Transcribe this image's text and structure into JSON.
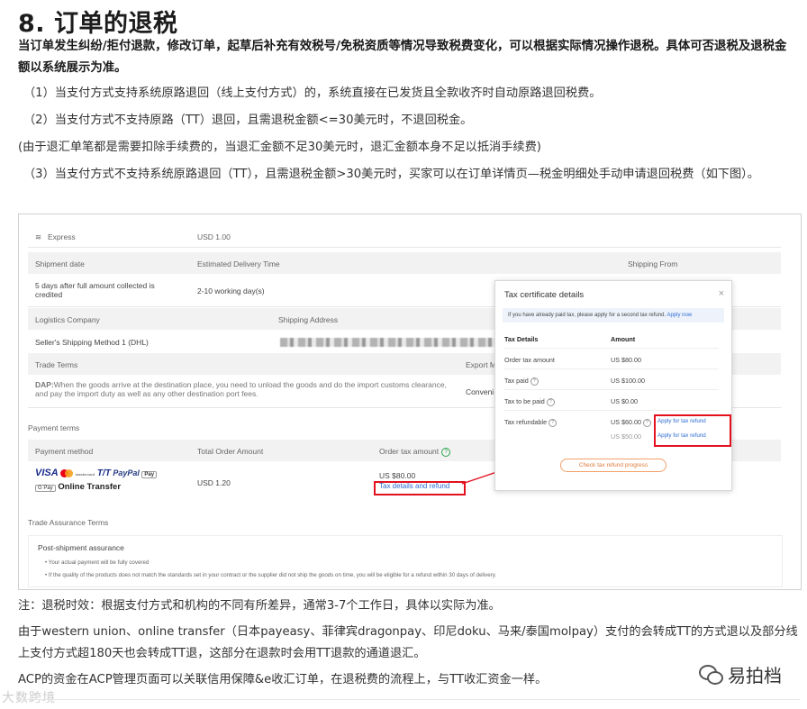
{
  "article": {
    "title": "8. 订单的退税",
    "lead": "当订单发生纠纷/拒付退款，修改订单，起草后补充有效税号/免税资质等情况导致税费变化，可以根据实际情况操作退税。具体可否退税及退税金额以系统展示为准。",
    "p1": "（1）当支付方式支持系统原路退回（线上支付方式）的，系统直接在已发货且全款收齐时自动原路退回税费。",
    "p2": "（2）当支付方式不支持原路（TT）退回，且需退税金额<=30美元时，不退回税金。",
    "p3": "(由于退汇单笔都是需要扣除手续费的，当退汇金额不足30美元时，退汇金额本身不足以抵消手续费)",
    "p4": "（3）当支付方式不支持系统原路退回（TT），且需退税金额>30美元时，买家可以在订单详情页—税金明细处手动申请退回税费（如下图）。",
    "note1": "注：退税时效：根据支付方式和机构的不同有所差异，通常3-7个工作日，具体以实际为准。",
    "note2": "由于western union、online transfer（日本payeasy、菲律宾dragonpay、印尼doku、马来/泰国molpay）支付的会转成TT的方式退以及部分线上支付方式超180天也会转成TT退，这部分在退款时会用TT退款的通道退汇。",
    "note3": "ACP的资金在ACP管理页面可以关联信用保障&e收汇订单，在退税费的流程上，与TT收汇资金一样。"
  },
  "screenshot": {
    "express_label": "Express",
    "express_value": "USD 1.00",
    "shipment_date_label": "Shipment date",
    "estimated_label": "Estimated Delivery Time",
    "shipping_from_label": "Shipping From",
    "shipment_date_value": "5 days after full amount collected is credited",
    "estimated_value": "2-10 working day(s)",
    "logistics_label": "Logistics Company",
    "shipping_address_label": "Shipping Address",
    "logistics_value": "Seller's Shipping Method 1 (DHL)",
    "trade_terms_label": "Trade Terms",
    "export_label": "Export M",
    "dap_text_bold": "DAP:",
    "dap_text": "When the goods arrive at the destination place, you need to unload the goods and do the import customs clearance, and pay the import duty as well as any other destination port fees.",
    "convenience": "Conveni",
    "payment_terms": "Payment terms",
    "payment_method_label": "Payment method",
    "total_order_label": "Total Order Amount",
    "order_tax_label": "Order tax amount",
    "visa": "VISA",
    "mastercard": "mastercard",
    "tt": "T/T",
    "paypal": "PayPal",
    "apple_pay": "Pay",
    "gpay": "G Pay",
    "online_transfer": "Online Transfer",
    "total_value": "USD 1.20",
    "tax_value": "US $80.00",
    "tax_details_link": "Tax details and refund",
    "trade_assurance": "Trade Assurance Terms",
    "post_shipment": "Post-shipment assurance",
    "bullet1": "Your actual payment will be fully covered",
    "bullet2": "If the quality of the products does not match the standards set in your contract or the supplier did not ship the goods on time, you will be eligible for a refund within 30 days of delivery.",
    "modal": {
      "title": "Tax certificate details",
      "close": "×",
      "note": "If you have already paid tax, please apply for a second tax refund.",
      "note_link": "Apply now",
      "col1": "Tax Details",
      "col2": "Amount",
      "rows": [
        {
          "label": "Order tax amount",
          "value": "US $80.00"
        },
        {
          "label": "Tax paid",
          "value": "US $100.00"
        },
        {
          "label": "Tax to be paid",
          "value": "US $0.00"
        },
        {
          "label": "Tax refundable",
          "value": "US $60.00"
        }
      ],
      "extra_value": "US $50.00",
      "apply1": "Apply for tax refund",
      "apply2": "Apply for tax refund",
      "progress": "Check tax refund progress"
    }
  },
  "watermark": {
    "brand": "易拍档",
    "corner": "大数跨境"
  }
}
